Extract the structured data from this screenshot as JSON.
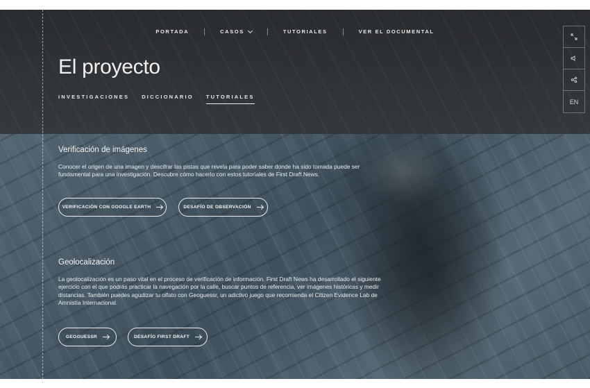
{
  "nav": {
    "items": [
      {
        "label": "PORTADA"
      },
      {
        "label": "CASOS"
      },
      {
        "label": "TUTORIALES"
      },
      {
        "label": "VER EL DOCUMENTAL"
      }
    ]
  },
  "header": {
    "title": "El proyecto",
    "tabs": [
      {
        "label": "INVESTIGACIONES"
      },
      {
        "label": "DICCIONARIO"
      },
      {
        "label": "TUTORIALES",
        "active": true
      }
    ]
  },
  "rail": {
    "fullscreen_icon": "expand-icon",
    "sound_icon": "speaker-icon",
    "share_icon": "share-icon",
    "language_label": "EN"
  },
  "sections": [
    {
      "heading": "Verificación de imágenes",
      "body": "Conocer el origen de una imagen y descifrar las pistas que revela para poder saber donde ha sido tomada puede ser fundamental para una investigación. Descubre cómo hacerlo con estos tutoriales de First Draft News.",
      "buttons": [
        {
          "label": "VERIFICACIÓN CON GOOGLE EARTH"
        },
        {
          "label": "DESAFÍO DE OBSERVACIÓN"
        }
      ]
    },
    {
      "heading": "Geolocalización",
      "body": "La geolocalización es un paso vital en el proceso de verificación de información. First Draft News ha desarrollado el siguiente ejercicio con el que podrás practicar la navegación por la calle, buscar puntos de referencia, ver imágenes históricas y medir distancias. También puedes agudizar tu olfato con Geoguessr, un adictivo juego que recomienda el Citizen Evidence Lab de Amnistía Internacional.",
      "buttons": [
        {
          "label": "GEOGUESSR"
        },
        {
          "label": "DESAFÍO FIRST DRAFT"
        }
      ]
    }
  ]
}
